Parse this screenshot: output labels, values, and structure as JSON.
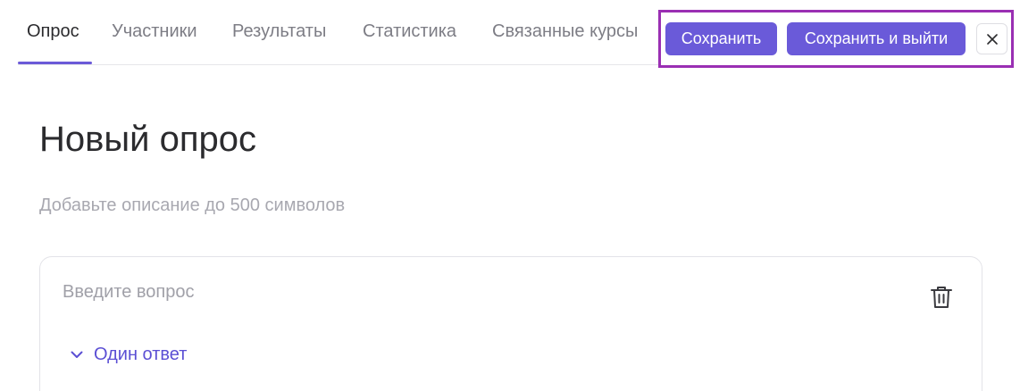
{
  "tabs": [
    {
      "label": "Опрос",
      "active": true
    },
    {
      "label": "Участники",
      "active": false
    },
    {
      "label": "Результаты",
      "active": false
    },
    {
      "label": "Статистика",
      "active": false
    },
    {
      "label": "Связанные курсы",
      "active": false
    }
  ],
  "actions": {
    "save_label": "Сохранить",
    "save_exit_label": "Сохранить и выйти",
    "close_icon": "close-icon"
  },
  "survey": {
    "title": "Новый опрос",
    "description_placeholder": "Добавьте описание до 500 символов"
  },
  "question": {
    "placeholder": "Введите вопрос",
    "answer_type": "Один ответ",
    "delete_icon": "trash-icon",
    "expand_icon": "chevron-down-icon"
  },
  "colors": {
    "accent": "#6a5ad9",
    "highlight_border": "#9a2fb3"
  }
}
